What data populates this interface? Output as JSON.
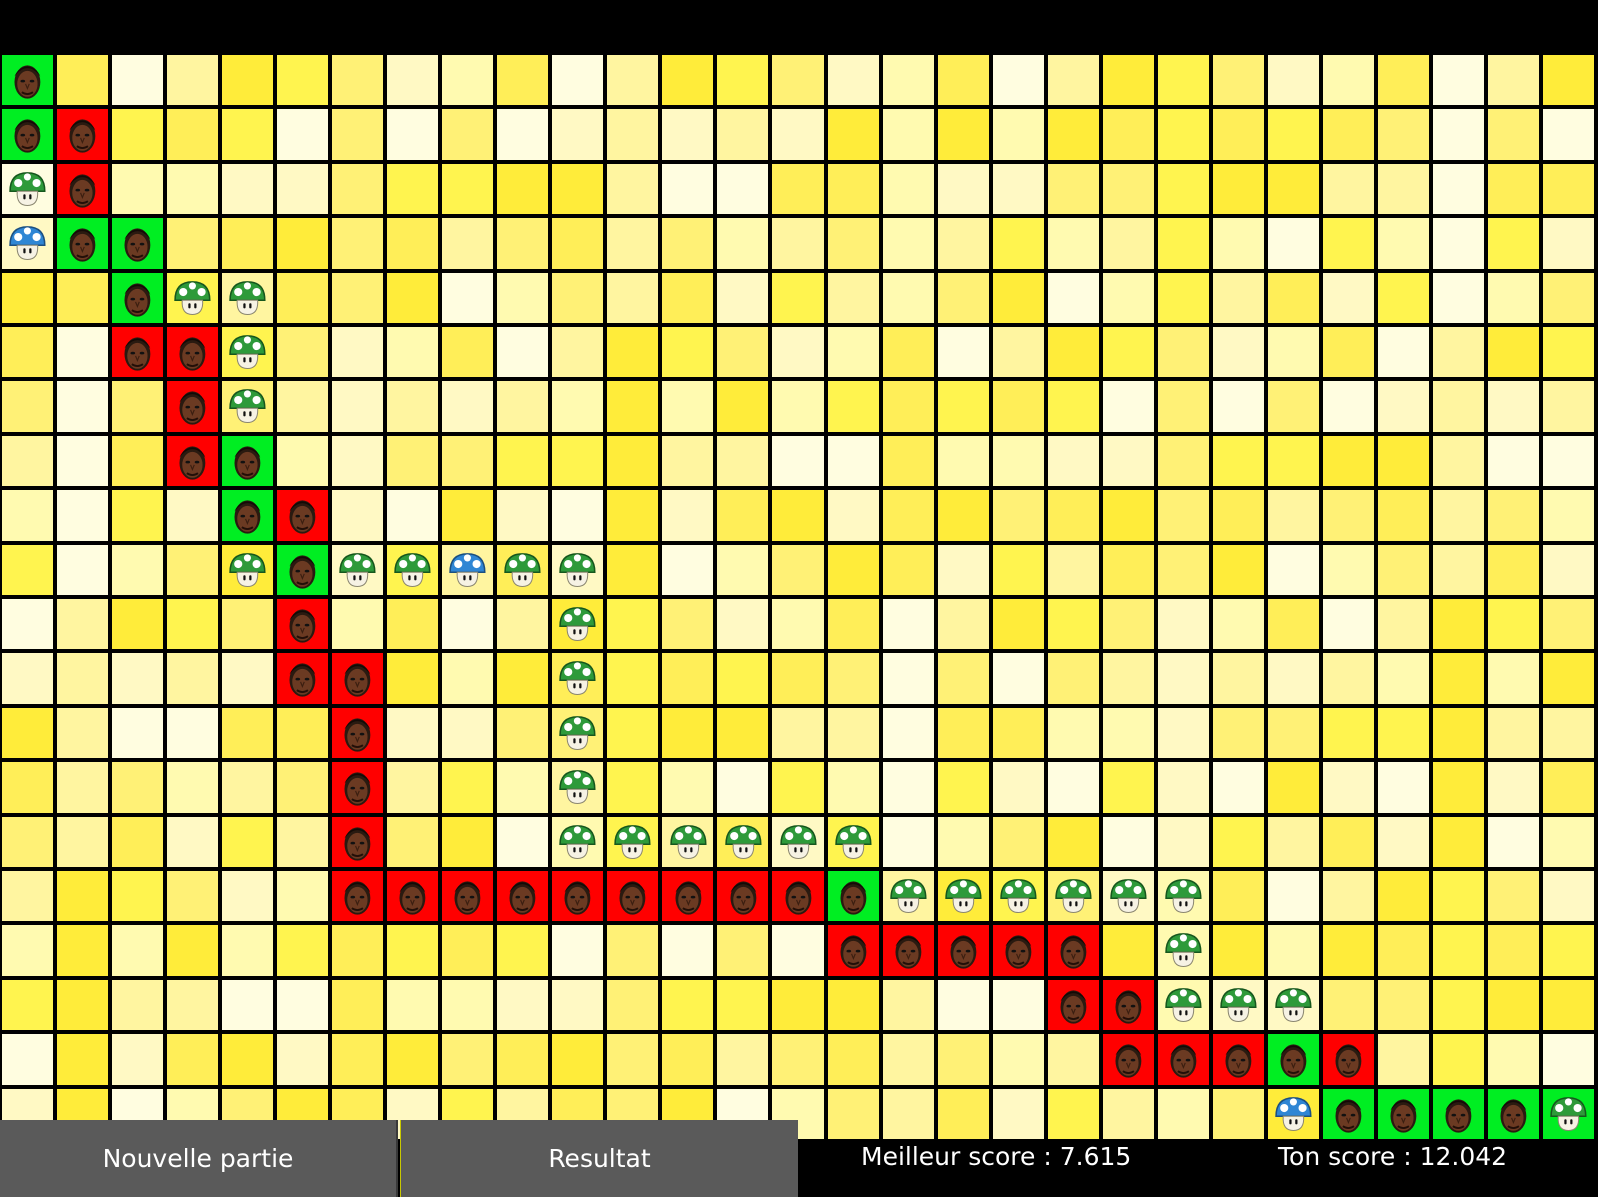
{
  "board": {
    "rows": 20,
    "cols": 29,
    "shades": [
      "#fffab0",
      "#fff5a0",
      "#fff176",
      "#ffee58",
      "#ffec3a",
      "#fff9c4",
      "#fffde0",
      "#fff44f"
    ],
    "colors": {
      "red": "#ff0000",
      "green": "#00ee22"
    },
    "pieces": [
      {
        "r": 0,
        "c": 0,
        "t": "face",
        "bg": "green"
      },
      {
        "r": 1,
        "c": 0,
        "t": "face",
        "bg": "green"
      },
      {
        "r": 1,
        "c": 1,
        "t": "face",
        "bg": "red"
      },
      {
        "r": 2,
        "c": 0,
        "t": "mush"
      },
      {
        "r": 2,
        "c": 1,
        "t": "face",
        "bg": "red"
      },
      {
        "r": 3,
        "c": 0,
        "t": "mush",
        "tone": "blue"
      },
      {
        "r": 3,
        "c": 1,
        "t": "face",
        "bg": "green"
      },
      {
        "r": 3,
        "c": 2,
        "t": "face",
        "bg": "green"
      },
      {
        "r": 4,
        "c": 2,
        "t": "face",
        "bg": "green"
      },
      {
        "r": 4,
        "c": 3,
        "t": "mush"
      },
      {
        "r": 4,
        "c": 4,
        "t": "mush"
      },
      {
        "r": 5,
        "c": 2,
        "t": "face",
        "bg": "red"
      },
      {
        "r": 5,
        "c": 3,
        "t": "face",
        "bg": "red"
      },
      {
        "r": 5,
        "c": 4,
        "t": "mush"
      },
      {
        "r": 6,
        "c": 3,
        "t": "face",
        "bg": "red"
      },
      {
        "r": 6,
        "c": 4,
        "t": "mush"
      },
      {
        "r": 7,
        "c": 3,
        "t": "face",
        "bg": "red"
      },
      {
        "r": 7,
        "c": 4,
        "t": "face",
        "bg": "green"
      },
      {
        "r": 8,
        "c": 4,
        "t": "face",
        "bg": "green"
      },
      {
        "r": 8,
        "c": 5,
        "t": "face",
        "bg": "red"
      },
      {
        "r": 9,
        "c": 4,
        "t": "mush"
      },
      {
        "r": 9,
        "c": 5,
        "t": "face",
        "bg": "green"
      },
      {
        "r": 9,
        "c": 6,
        "t": "mush"
      },
      {
        "r": 9,
        "c": 7,
        "t": "mush"
      },
      {
        "r": 9,
        "c": 8,
        "t": "mush",
        "tone": "blue"
      },
      {
        "r": 9,
        "c": 9,
        "t": "mush"
      },
      {
        "r": 9,
        "c": 10,
        "t": "mush"
      },
      {
        "r": 10,
        "c": 5,
        "t": "face",
        "bg": "red"
      },
      {
        "r": 10,
        "c": 10,
        "t": "mush"
      },
      {
        "r": 11,
        "c": 5,
        "t": "face",
        "bg": "red"
      },
      {
        "r": 11,
        "c": 6,
        "t": "face",
        "bg": "red"
      },
      {
        "r": 11,
        "c": 10,
        "t": "mush"
      },
      {
        "r": 12,
        "c": 6,
        "t": "face",
        "bg": "red"
      },
      {
        "r": 12,
        "c": 10,
        "t": "mush"
      },
      {
        "r": 13,
        "c": 6,
        "t": "face",
        "bg": "red"
      },
      {
        "r": 13,
        "c": 10,
        "t": "mush"
      },
      {
        "r": 14,
        "c": 6,
        "t": "face",
        "bg": "red"
      },
      {
        "r": 14,
        "c": 10,
        "t": "mush"
      },
      {
        "r": 14,
        "c": 11,
        "t": "mush"
      },
      {
        "r": 14,
        "c": 12,
        "t": "mush"
      },
      {
        "r": 14,
        "c": 13,
        "t": "mush"
      },
      {
        "r": 14,
        "c": 14,
        "t": "mush"
      },
      {
        "r": 14,
        "c": 15,
        "t": "mush"
      },
      {
        "r": 15,
        "c": 6,
        "t": "face",
        "bg": "red"
      },
      {
        "r": 15,
        "c": 7,
        "t": "face",
        "bg": "red"
      },
      {
        "r": 15,
        "c": 8,
        "t": "face",
        "bg": "red"
      },
      {
        "r": 15,
        "c": 9,
        "t": "face",
        "bg": "red"
      },
      {
        "r": 15,
        "c": 10,
        "t": "face",
        "bg": "red"
      },
      {
        "r": 15,
        "c": 11,
        "t": "face",
        "bg": "red"
      },
      {
        "r": 15,
        "c": 12,
        "t": "face",
        "bg": "red"
      },
      {
        "r": 15,
        "c": 13,
        "t": "face",
        "bg": "red"
      },
      {
        "r": 15,
        "c": 14,
        "t": "face",
        "bg": "red"
      },
      {
        "r": 15,
        "c": 15,
        "t": "face",
        "bg": "green"
      },
      {
        "r": 15,
        "c": 16,
        "t": "mush"
      },
      {
        "r": 15,
        "c": 17,
        "t": "mush"
      },
      {
        "r": 15,
        "c": 18,
        "t": "mush"
      },
      {
        "r": 15,
        "c": 19,
        "t": "mush"
      },
      {
        "r": 15,
        "c": 20,
        "t": "mush"
      },
      {
        "r": 15,
        "c": 21,
        "t": "mush"
      },
      {
        "r": 16,
        "c": 15,
        "t": "face",
        "bg": "red"
      },
      {
        "r": 16,
        "c": 16,
        "t": "face",
        "bg": "red"
      },
      {
        "r": 16,
        "c": 17,
        "t": "face",
        "bg": "red"
      },
      {
        "r": 16,
        "c": 18,
        "t": "face",
        "bg": "red"
      },
      {
        "r": 16,
        "c": 19,
        "t": "face",
        "bg": "red"
      },
      {
        "r": 16,
        "c": 21,
        "t": "mush"
      },
      {
        "r": 17,
        "c": 19,
        "t": "face",
        "bg": "red"
      },
      {
        "r": 17,
        "c": 20,
        "t": "face",
        "bg": "red"
      },
      {
        "r": 17,
        "c": 21,
        "t": "mush"
      },
      {
        "r": 17,
        "c": 22,
        "t": "mush"
      },
      {
        "r": 17,
        "c": 23,
        "t": "mush"
      },
      {
        "r": 18,
        "c": 20,
        "t": "face",
        "bg": "red"
      },
      {
        "r": 18,
        "c": 21,
        "t": "face",
        "bg": "red"
      },
      {
        "r": 18,
        "c": 22,
        "t": "face",
        "bg": "red"
      },
      {
        "r": 18,
        "c": 23,
        "t": "face",
        "bg": "green"
      },
      {
        "r": 18,
        "c": 24,
        "t": "face",
        "bg": "red"
      },
      {
        "r": 19,
        "c": 23,
        "t": "mush",
        "tone": "blue"
      },
      {
        "r": 19,
        "c": 24,
        "t": "face",
        "bg": "green"
      },
      {
        "r": 19,
        "c": 25,
        "t": "face",
        "bg": "green"
      },
      {
        "r": 19,
        "c": 26,
        "t": "face",
        "bg": "green"
      },
      {
        "r": 19,
        "c": 27,
        "t": "face",
        "bg": "green"
      },
      {
        "r": 19,
        "c": 28,
        "t": "mush",
        "bg": "green"
      }
    ]
  },
  "buttons": {
    "new_game": "Nouvelle partie",
    "result": "Resultat"
  },
  "scores": {
    "best": "Meilleur score : 7.615",
    "yours": "Ton score : 12.042"
  }
}
